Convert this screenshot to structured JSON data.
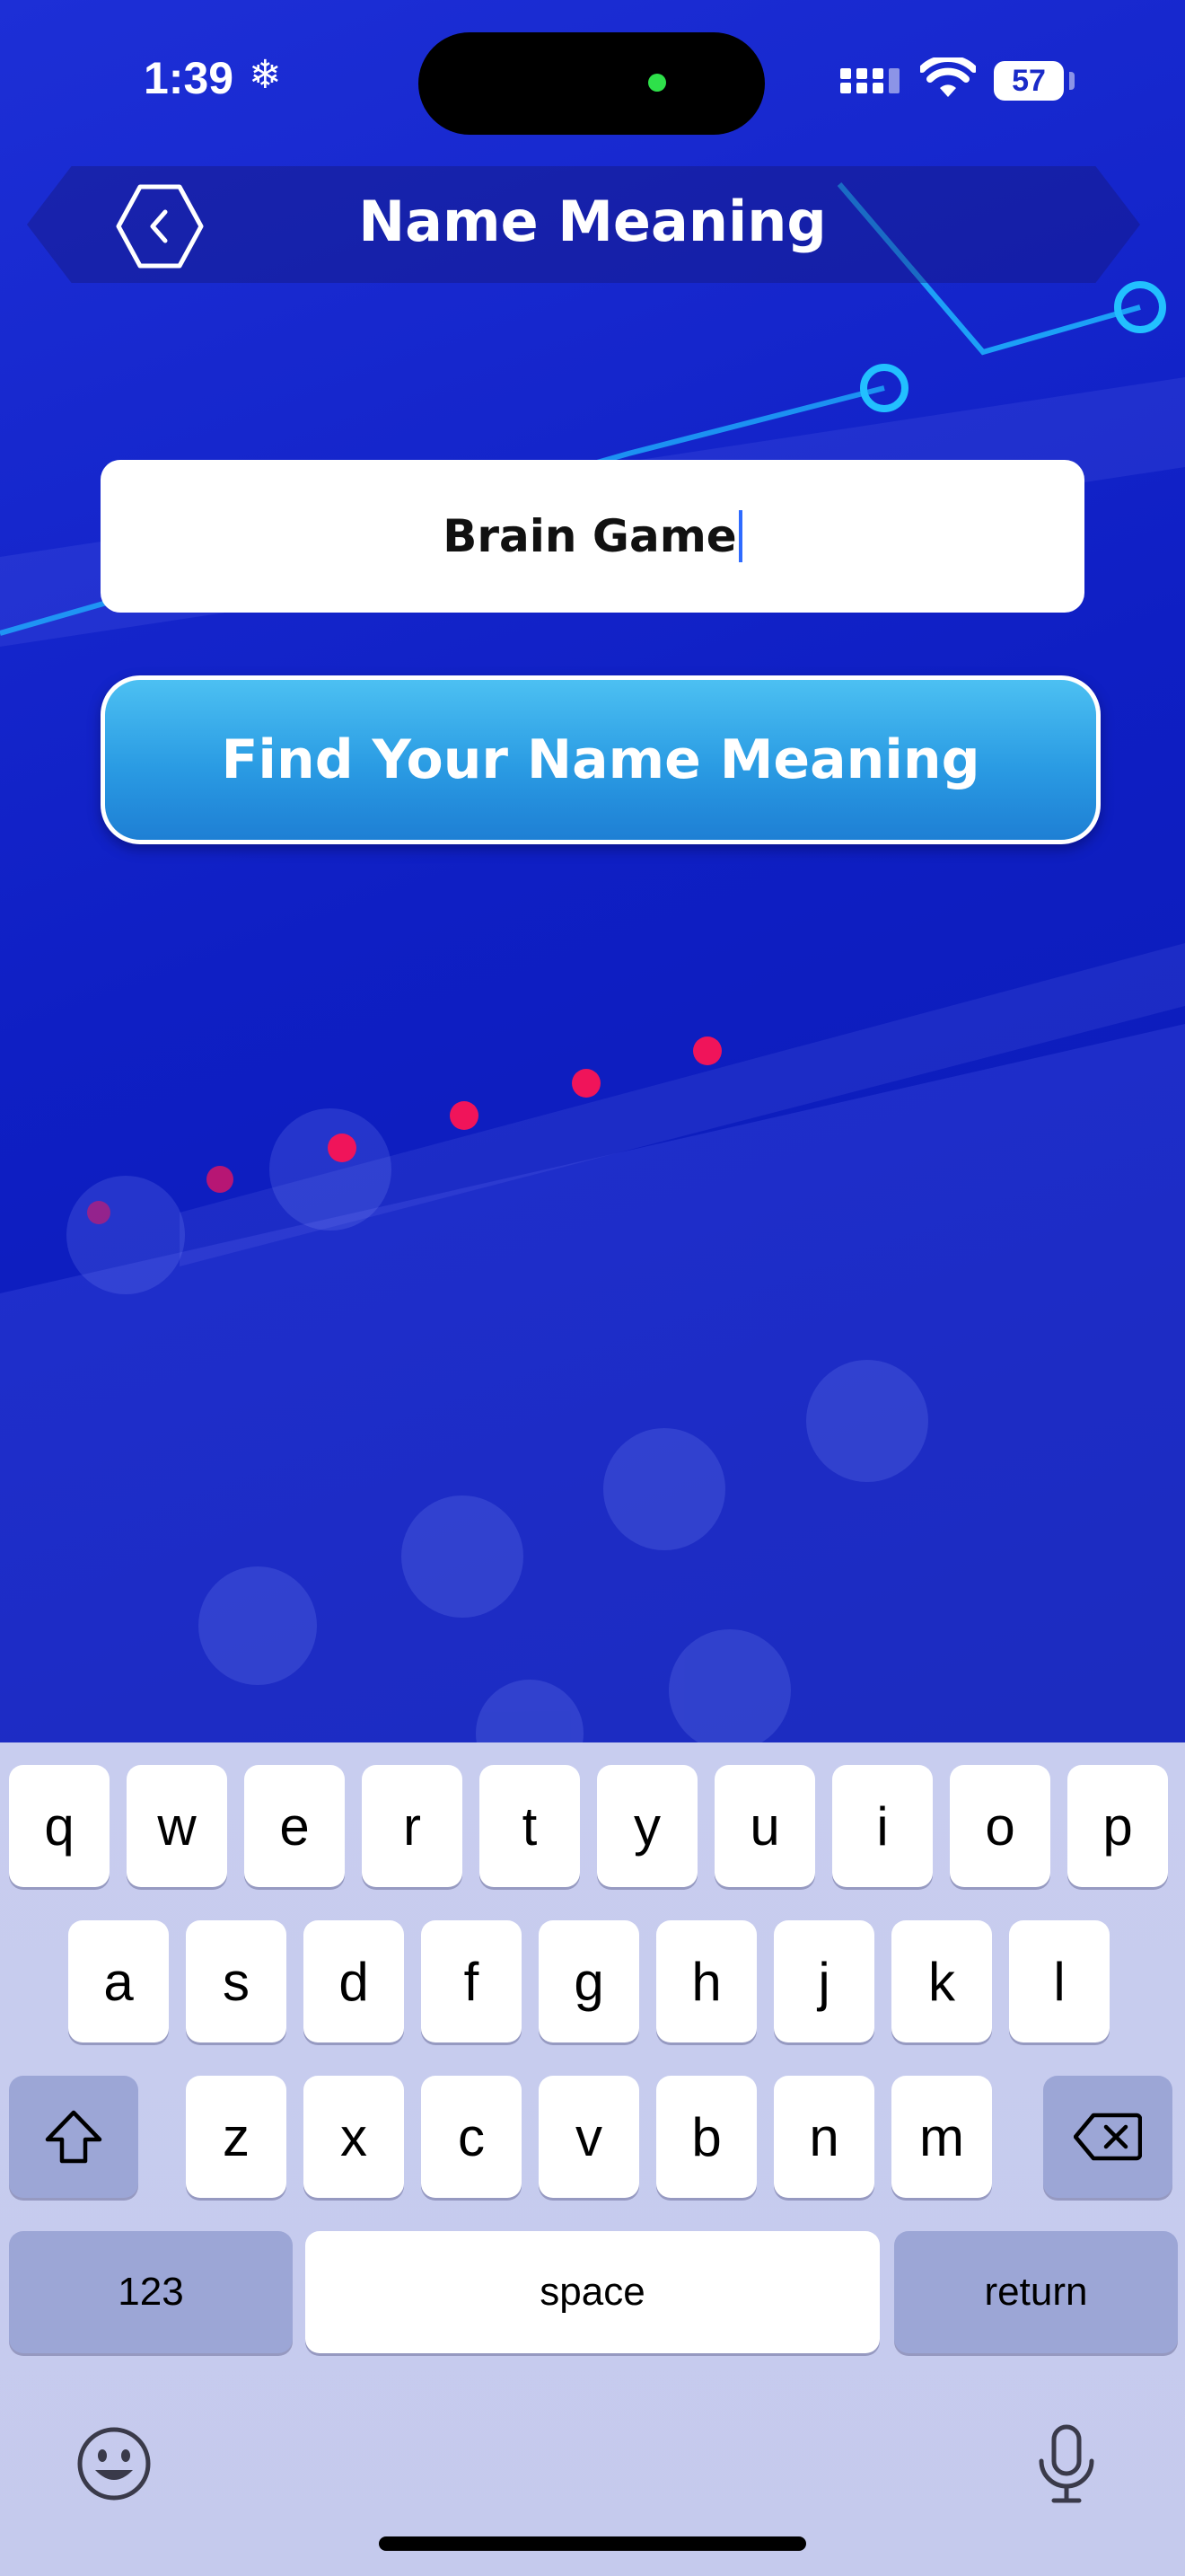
{
  "status": {
    "time": "1:39",
    "battery": "57"
  },
  "header": {
    "title": "Name Meaning"
  },
  "input": {
    "value": "Brain Game"
  },
  "button": {
    "label": "Find Your Name Meaning"
  },
  "keyboard": {
    "row1": [
      "q",
      "w",
      "e",
      "r",
      "t",
      "y",
      "u",
      "i",
      "o",
      "p"
    ],
    "row2": [
      "a",
      "s",
      "d",
      "f",
      "g",
      "h",
      "j",
      "k",
      "l"
    ],
    "row3": [
      "z",
      "x",
      "c",
      "v",
      "b",
      "n",
      "m"
    ],
    "numbers_label": "123",
    "space_label": "space",
    "return_label": "return"
  },
  "icons": {
    "back": "chevron-left-hexagon-icon",
    "shift": "shift-icon",
    "delete": "backspace-icon",
    "emoji": "emoji-icon",
    "mic": "microphone-icon"
  },
  "colors": {
    "background": "#0f1fc4",
    "button": "#2a9be3",
    "accent_dots": "#f0145a",
    "keyboard": "#c8cdef"
  }
}
